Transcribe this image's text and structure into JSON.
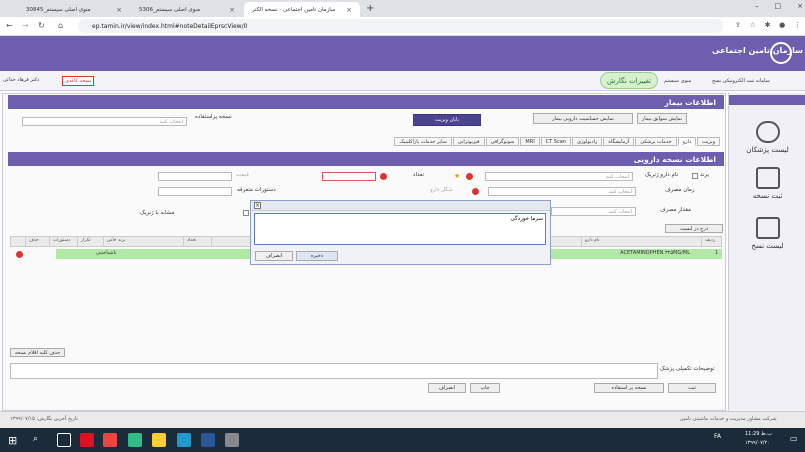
{
  "browser": {
    "tabs": [
      {
        "title": "منوی اصلی سیستم_30845"
      },
      {
        "title": "منوی اصلی سیستم_5306"
      },
      {
        "title": "سازمان تامین اجتماعی - نسخه الکتر"
      }
    ],
    "url": "ep.tamin.ir/view/index.html#noteDetailEprscView/0"
  },
  "app": {
    "org_name": "سازمان تامین اجتماعی",
    "breadcrumb": "سامانه ثبت الکترونیکی نسخ",
    "main_menu": "منوی سیستم",
    "page_button": "تغییرات نگارش",
    "doctor": "دکتر فرهاد خدائی",
    "paper_rx": "نسخه کاغذی"
  },
  "sidebar": {
    "items": [
      {
        "label": "لیست پزشکان"
      },
      {
        "label": "ثبت نسخه"
      },
      {
        "label": "لیست نسخ"
      }
    ]
  },
  "patient": {
    "header": "اطلاعات بیمار",
    "btn_history": "نمایش سوابق بیمار",
    "btn_allergy": "نمایش حساسیت دارویی بیمار",
    "btn_end_visit": "پایان ویزیت",
    "recurring_label": "نسخه پراستفاده",
    "recurring_placeholder": "انتخاب کنید"
  },
  "tabs": [
    "ویزیت",
    "دارو",
    "خدمات پزشکی",
    "آزمایشگاه",
    "رادیولوژی",
    "CT Scan",
    "MRI",
    "سونوگرافی",
    "فیزیوتراپی",
    "سایر خدمات پاراکلینیک"
  ],
  "drug": {
    "header": "اطلاعات نسخه دارویی",
    "brand_label": "برند",
    "generic_label": "نام دارو ژنریک",
    "generic_placeholder": "انتخاب کنید",
    "count_label": "تعداد",
    "time_label": "زمان مصرف",
    "time_placeholder": "انتخاب کنید",
    "dose_label": "مقدار مصرف",
    "dose_placeholder": "انتخاب کنید",
    "instructions_label": "دستورات متفرقه",
    "show_label": "شکل دارو",
    "also_label": "داروهای غیر بیمه ای",
    "also_label2": "مشابه با ژنریک",
    "btn_add": "درج در لیست",
    "grid_headers": [
      "ردیف",
      "نام دارو",
      "تعداد",
      "برند خاص",
      "تکرار",
      "دستورات",
      "حذف"
    ],
    "row_name": "ACETAMINOPHEN ۳۲۵MG/ML",
    "row_code": "ناشناختنی",
    "btn_delete_all": "حذف کلیه اقلام نسخه"
  },
  "notes": {
    "label": "توضیحات تکمیلی پزشک"
  },
  "footer": {
    "btn_send": "ثبت",
    "btn_recurring": "نسخه پر استفاده",
    "btn_print": "چاپ",
    "btn_cancel": "انصراف",
    "last_edit": "تاریخ آخرین نگارش: ۱۳۹۹/۰۷/۱۵",
    "company": "شرکت مشاور مدیریت و خدمات ماشینی تامین"
  },
  "modal": {
    "text": "سرما خوردگی",
    "btn_save": "ذخیره",
    "btn_cancel": "انصراف"
  },
  "taskbar": {
    "time": "11:29 ب.ظ",
    "date": "۱۳۹۹/۰۷/۲۰",
    "lang": "FA"
  }
}
